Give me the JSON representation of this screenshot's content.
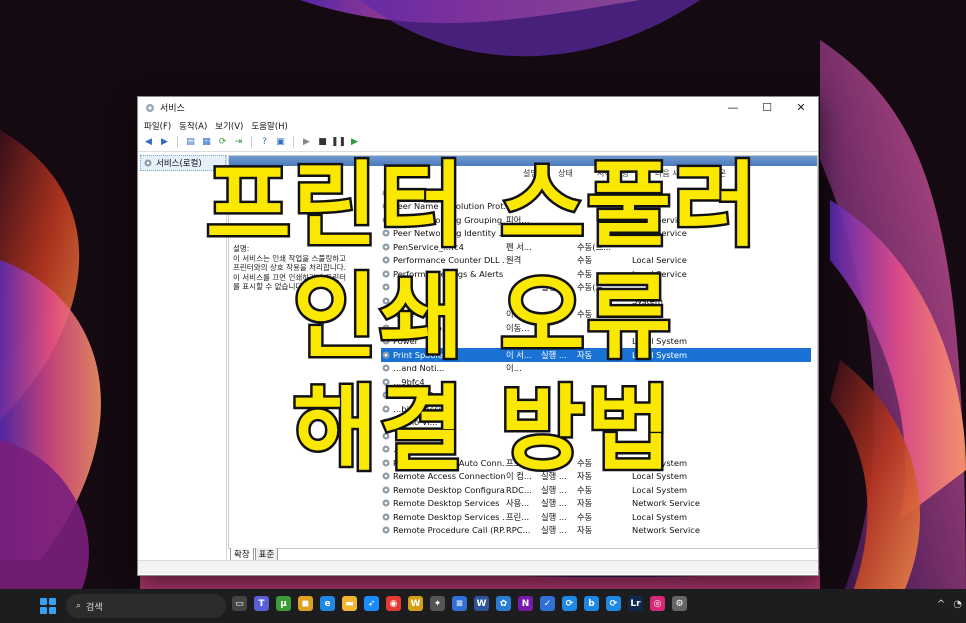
{
  "window": {
    "title": "서비스",
    "menu": [
      "파일(F)",
      "동작(A)",
      "보기(V)",
      "도움말(H)"
    ],
    "controls": {
      "minimize": "—",
      "maximize": "☐",
      "close": "✕"
    }
  },
  "tree": {
    "item": "서비스(로컬)"
  },
  "panel": {
    "header": "서비스(로컬)",
    "description_label": "설명:",
    "description_lines": [
      "이 서비스는 인쇄 작업을 스풀링하고",
      "프린터와의 상호 작용을 처리합니다.",
      "이 서비스를 끄면 인쇄하거나 프린터",
      "를 표시할 수 없습니다."
    ]
  },
  "columns": [
    "설명",
    "상태",
    "시작 유형",
    "다음 사용자로 로그온"
  ],
  "rows": [
    {
      "name": "…9bfc4",
      "desc": "",
      "state": "",
      "start": "",
      "logon": ""
    },
    {
      "name": "Peer Name Resolution Prot...",
      "desc": "",
      "state": "",
      "start": "",
      "logon": ""
    },
    {
      "name": "Peer Networking Grouping",
      "desc": "피어…",
      "state": "",
      "start": "",
      "logon": "Local Service"
    },
    {
      "name": "Peer Networking Identity ...",
      "desc": "",
      "state": "",
      "start": "",
      "logon": "Local Service"
    },
    {
      "name": "PenService_…fc4",
      "desc": "펜 서...",
      "state": "",
      "start": "수동(트...",
      "logon": ""
    },
    {
      "name": "Performance Counter DLL ...",
      "desc": "원격",
      "state": "",
      "start": "수동",
      "logon": "Local Service"
    },
    {
      "name": "Performance Logs & Alerts",
      "desc": "",
      "state": "",
      "start": "수동",
      "logon": "Local Service"
    },
    {
      "name": "",
      "desc": "",
      "state": "실행 ...",
      "start": "수동(트...",
      "logon": ""
    },
    {
      "name": "",
      "desc": "",
      "state": "",
      "start": "",
      "logon": "System"
    },
    {
      "name": "…me Publi...",
      "desc": "이…",
      "state": "",
      "start": "수동",
      "logon": ""
    },
    {
      "name": "…numerato...",
      "desc": "이동…",
      "state": "",
      "start": "",
      "logon": ""
    },
    {
      "name": "Power",
      "desc": "",
      "state": "",
      "start": "",
      "logon": "Local System"
    },
    {
      "name": "Print Spooler",
      "desc": "이 서...",
      "state": "실행 ...",
      "start": "자동",
      "logon": "Local System",
      "selected": true
    },
    {
      "name": "…and Noti...",
      "desc": "이…",
      "state": "",
      "start": "",
      "logon": ""
    },
    {
      "name": "…9bfc4",
      "desc": "",
      "state": "",
      "start": "",
      "logon": ""
    },
    {
      "name": "…ontrol P...",
      "desc": "",
      "state": "",
      "start": "",
      "logon": ""
    },
    {
      "name": "…bility Assi...",
      "desc": "",
      "state": "",
      "start": "",
      "logon": ""
    },
    {
      "name": "…udio Vi...",
      "desc": "",
      "state": "",
      "start": "",
      "logon": ""
    },
    {
      "name": "",
      "desc": "",
      "state": "",
      "start": "",
      "logon": ""
    },
    {
      "name": "…evice ...",
      "desc": "",
      "state": "",
      "start": "",
      "logon": ""
    },
    {
      "name": "Remote Access Auto Conn...",
      "desc": "프로…",
      "state": "",
      "start": "수동",
      "logon": "Local System"
    },
    {
      "name": "Remote Access Connection...",
      "desc": "이 컴...",
      "state": "실행 ...",
      "start": "자동",
      "logon": "Local System"
    },
    {
      "name": "Remote Desktop Configura...",
      "desc": "RDC...",
      "state": "실행 ...",
      "start": "수동",
      "logon": "Local System"
    },
    {
      "name": "Remote Desktop Services",
      "desc": "사용...",
      "state": "실행 ...",
      "start": "자동",
      "logon": "Network Service"
    },
    {
      "name": "Remote Desktop Services ...",
      "desc": "프린...",
      "state": "실행 ...",
      "start": "수동",
      "logon": "Local System"
    },
    {
      "name": "Remote Procedure Call (RP...",
      "desc": "RPC...",
      "state": "실행 ...",
      "start": "자동",
      "logon": "Network Service"
    }
  ],
  "tabs": [
    "확장",
    "표준"
  ],
  "headline": [
    "프린터 스풀러",
    "인쇄 오류",
    "해결 방법"
  ],
  "taskbar": {
    "search_label": "검색",
    "icons": [
      "task-view-icon",
      "teams-icon",
      "utorrent-icon",
      "store-icon",
      "edge-icon",
      "explorer-icon",
      "bluesky-icon",
      "chrome-icon",
      "winamp-icon",
      "resolve-icon",
      "notepad-icon",
      "word-icon",
      "teams-alt-icon",
      "onenote-icon",
      "todo-icon",
      "sync-icon",
      "bing-icon",
      "sync2-icon",
      "lightroom-icon",
      "instagram-icon",
      "services-icon"
    ],
    "badge": "1"
  },
  "colors": {
    "selection": "#1a73d4",
    "headline_fill": "#fbe800",
    "headline_stroke": "#111111"
  }
}
